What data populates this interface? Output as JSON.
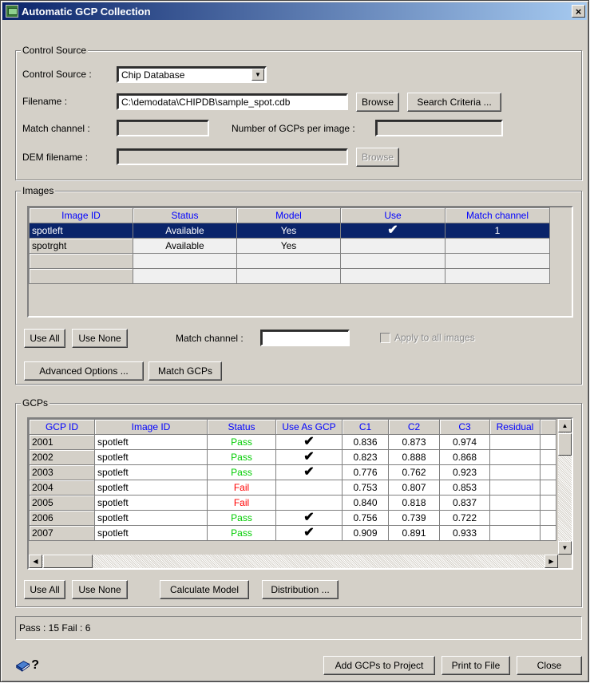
{
  "window": {
    "title": "Automatic GCP Collection",
    "close_glyph": "×"
  },
  "control_source": {
    "group_label": "Control Source",
    "source_label": "Control Source :",
    "source_value": "Chip Database",
    "filename_label": "Filename :",
    "filename_value": "C:\\demodata\\CHIPDB\\sample_spot.cdb",
    "browse_label": "Browse",
    "search_criteria_label": "Search Criteria ...",
    "match_channel_label": "Match channel :",
    "match_channel_value": "",
    "gcps_per_image_label": "Number of GCPs per image :",
    "gcps_per_image_value": "",
    "dem_label": "DEM filename :",
    "dem_value": "",
    "dem_browse_label": "Browse"
  },
  "images": {
    "group_label": "Images",
    "columns": [
      "Image ID",
      "Status",
      "Model",
      "Use",
      "Match channel"
    ],
    "rows": [
      {
        "id": "spotleft",
        "status": "Available",
        "model": "Yes",
        "use": "✔",
        "match_channel": "1",
        "selected": true
      },
      {
        "id": "spotrght",
        "status": "Available",
        "model": "Yes",
        "use": "",
        "match_channel": "",
        "selected": false
      },
      {
        "id": "",
        "status": "",
        "model": "",
        "use": "",
        "match_channel": "",
        "selected": false
      },
      {
        "id": "",
        "status": "",
        "model": "",
        "use": "",
        "match_channel": "",
        "selected": false
      }
    ],
    "use_all_label": "Use All",
    "use_none_label": "Use None",
    "match_channel_label": "Match channel :",
    "match_channel_value": "",
    "apply_all_label": "Apply to all images",
    "advanced_label": "Advanced Options ...",
    "match_gcps_label": "Match GCPs"
  },
  "gcps": {
    "group_label": "GCPs",
    "columns": [
      "GCP ID",
      "Image ID",
      "Status",
      "Use As GCP",
      "C1",
      "C2",
      "C3",
      "Residual"
    ],
    "rows": [
      {
        "gcp_id": "2001",
        "image_id": "spotleft",
        "status": "Pass",
        "use": "✔",
        "c1": "0.836",
        "c2": "0.873",
        "c3": "0.974",
        "residual": ""
      },
      {
        "gcp_id": "2002",
        "image_id": "spotleft",
        "status": "Pass",
        "use": "✔",
        "c1": "0.823",
        "c2": "0.888",
        "c3": "0.868",
        "residual": ""
      },
      {
        "gcp_id": "2003",
        "image_id": "spotleft",
        "status": "Pass",
        "use": "✔",
        "c1": "0.776",
        "c2": "0.762",
        "c3": "0.923",
        "residual": ""
      },
      {
        "gcp_id": "2004",
        "image_id": "spotleft",
        "status": "Fail",
        "use": "",
        "c1": "0.753",
        "c2": "0.807",
        "c3": "0.853",
        "residual": ""
      },
      {
        "gcp_id": "2005",
        "image_id": "spotleft",
        "status": "Fail",
        "use": "",
        "c1": "0.840",
        "c2": "0.818",
        "c3": "0.837",
        "residual": ""
      },
      {
        "gcp_id": "2006",
        "image_id": "spotleft",
        "status": "Pass",
        "use": "✔",
        "c1": "0.756",
        "c2": "0.739",
        "c3": "0.722",
        "residual": ""
      },
      {
        "gcp_id": "2007",
        "image_id": "spotleft",
        "status": "Pass",
        "use": "✔",
        "c1": "0.909",
        "c2": "0.891",
        "c3": "0.933",
        "residual": ""
      }
    ],
    "use_all_label": "Use All",
    "use_none_label": "Use None",
    "calculate_label": "Calculate Model",
    "distribution_label": "Distribution ..."
  },
  "status": {
    "text": "Pass : 15  Fail : 6"
  },
  "footer": {
    "help_glyph": "?",
    "add_gcps_label": "Add GCPs to Project",
    "print_label": "Print to File",
    "close_label": "Close"
  },
  "colors": {
    "pass": "#00cc00",
    "fail": "#ff0000",
    "header_text": "#0000ff",
    "selection": "#0a246a"
  }
}
